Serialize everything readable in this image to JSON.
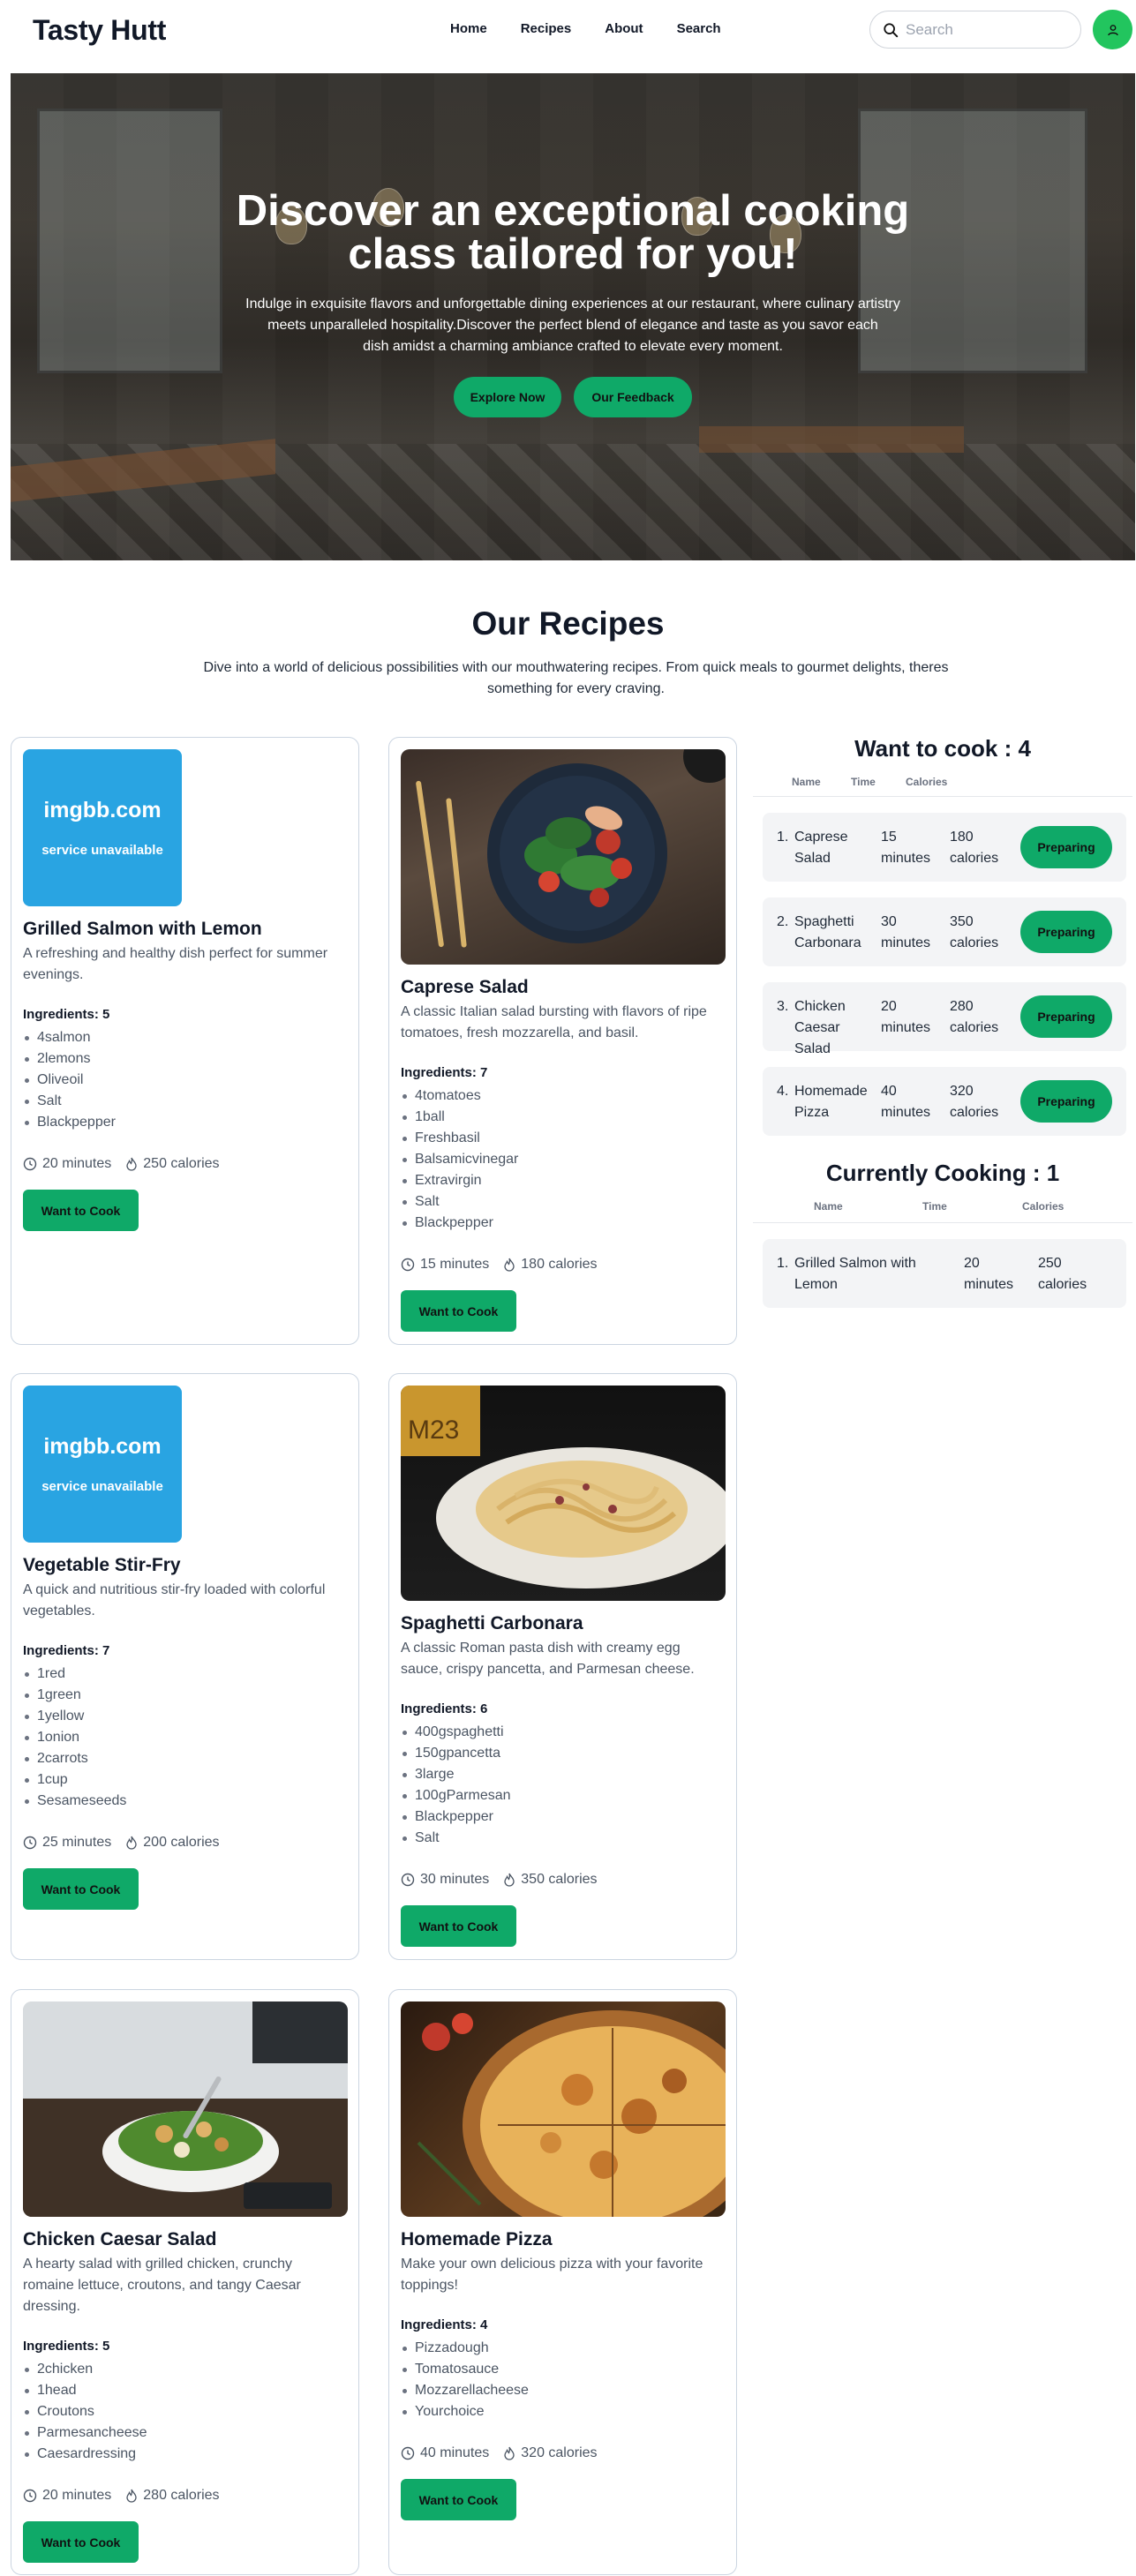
{
  "nav": {
    "brand": "Tasty Hutt",
    "links": [
      "Home",
      "Recipes",
      "About",
      "Search"
    ],
    "search_placeholder": "Search",
    "icons": {
      "search": "search-icon",
      "avatar": "user-icon"
    }
  },
  "hero": {
    "title": "Discover an exceptional cooking class tailored for you!",
    "text_line1": "Indulge in exquisite flavors and unforgettable dining experiences at our restaurant, where culinary artistry meets unparalleled hospitality.Discover the perfect blend of elegance and taste as you savor each",
    "text_line2": "dish amidst a charming ambiance crafted to elevate every moment.",
    "explore_label": "Explore Now",
    "feedback_label": "Our Feedback"
  },
  "recipes_section": {
    "title": "Our Recipes",
    "subtitle": "Dive into a world of delicious possibilities with our mouthwatering recipes. From quick meals to gourmet delights, theres something for every craving."
  },
  "placeholder": {
    "line1": "imgbb.com",
    "line2": "service unavailable"
  },
  "cards": [
    {
      "title": "Grilled Salmon with Lemon",
      "desc": "A refreshing and healthy dish perfect for summer evenings.",
      "ingredients_label": "Ingredients: 5",
      "ingredients": [
        "4salmon",
        "2lemons",
        "Oliveoil",
        "Salt",
        "Blackpepper"
      ],
      "time": "20 minutes",
      "calories": "250 calories",
      "button": "Want to Cook"
    },
    {
      "title": "Caprese Salad",
      "desc": "A classic Italian salad bursting with flavors of ripe tomatoes, fresh mozzarella, and basil.",
      "ingredients_label": "Ingredients: 7",
      "ingredients": [
        "4tomatoes",
        "1ball",
        "Freshbasil",
        "Balsamicvinegar",
        "Extravirgin",
        "Salt",
        "Blackpepper"
      ],
      "time": "15 minutes",
      "calories": "180 calories",
      "button": "Want to Cook"
    },
    {
      "title": "Vegetable Stir-Fry",
      "desc": "A quick and nutritious stir-fry loaded with colorful vegetables.",
      "ingredients_label": "Ingredients: 7",
      "ingredients": [
        "1red",
        "1green",
        "1yellow",
        "1onion",
        "2carrots",
        "1cup",
        "Sesameseeds"
      ],
      "time": "25 minutes",
      "calories": "200 calories",
      "button": "Want to Cook"
    },
    {
      "title": "Spaghetti Carbonara",
      "desc": "A classic Roman pasta dish with creamy egg sauce, crispy pancetta, and Parmesan cheese.",
      "ingredients_label": "Ingredients: 6",
      "ingredients": [
        "400gspaghetti",
        "150gpancetta",
        "3large",
        "100gParmesan",
        "Blackpepper",
        "Salt"
      ],
      "time": "30 minutes",
      "calories": "350 calories",
      "button": "Want to Cook"
    },
    {
      "title": "Chicken Caesar Salad",
      "desc": "A hearty salad with grilled chicken, crunchy romaine lettuce, croutons, and tangy Caesar dressing.",
      "ingredients_label": "Ingredients: 5",
      "ingredients": [
        "2chicken",
        "1head",
        "Croutons",
        "Parmesancheese",
        "Caesardressing"
      ],
      "time": "20 minutes",
      "calories": "280 calories",
      "button": "Want to Cook"
    },
    {
      "title": "Homemade Pizza",
      "desc": "Make your own delicious pizza with your favorite toppings!",
      "ingredients_label": "Ingredients: 4",
      "ingredients": [
        "Pizzadough",
        "Tomatosauce",
        "Mozzarellacheese",
        "Yourchoice"
      ],
      "time": "40 minutes",
      "calories": "320 calories",
      "button": "Want to Cook"
    }
  ],
  "want_to_cook": {
    "title": "Want to cook : 4",
    "headers": [
      "Name",
      "Time",
      "Calories"
    ],
    "rows": [
      {
        "num": "1.",
        "name": "Caprese Salad",
        "time": "15 minutes",
        "calories": "180 calories",
        "action": "Preparing"
      },
      {
        "num": "2.",
        "name": "Spaghetti Carbonara",
        "time": "30 minutes",
        "calories": "350 calories",
        "action": "Preparing"
      },
      {
        "num": "3.",
        "name": "Chicken Caesar Salad",
        "time": "20 minutes",
        "calories": "280 calories",
        "action": "Preparing"
      },
      {
        "num": "4.",
        "name": "Homemade Pizza",
        "time": "40 minutes",
        "calories": "320 calories",
        "action": "Preparing"
      }
    ]
  },
  "currently_cooking": {
    "title": "Currently Cooking : 1",
    "headers": [
      "Name",
      "Time",
      "Calories"
    ],
    "rows": [
      {
        "num": "1.",
        "name": "Grilled Salmon with Lemon",
        "time": "20 minutes",
        "calories": "250 calories"
      }
    ]
  },
  "colors": {
    "accent": "#0fa968",
    "placeholder_bg": "#29a4e2",
    "avatar": "#22c55e"
  }
}
